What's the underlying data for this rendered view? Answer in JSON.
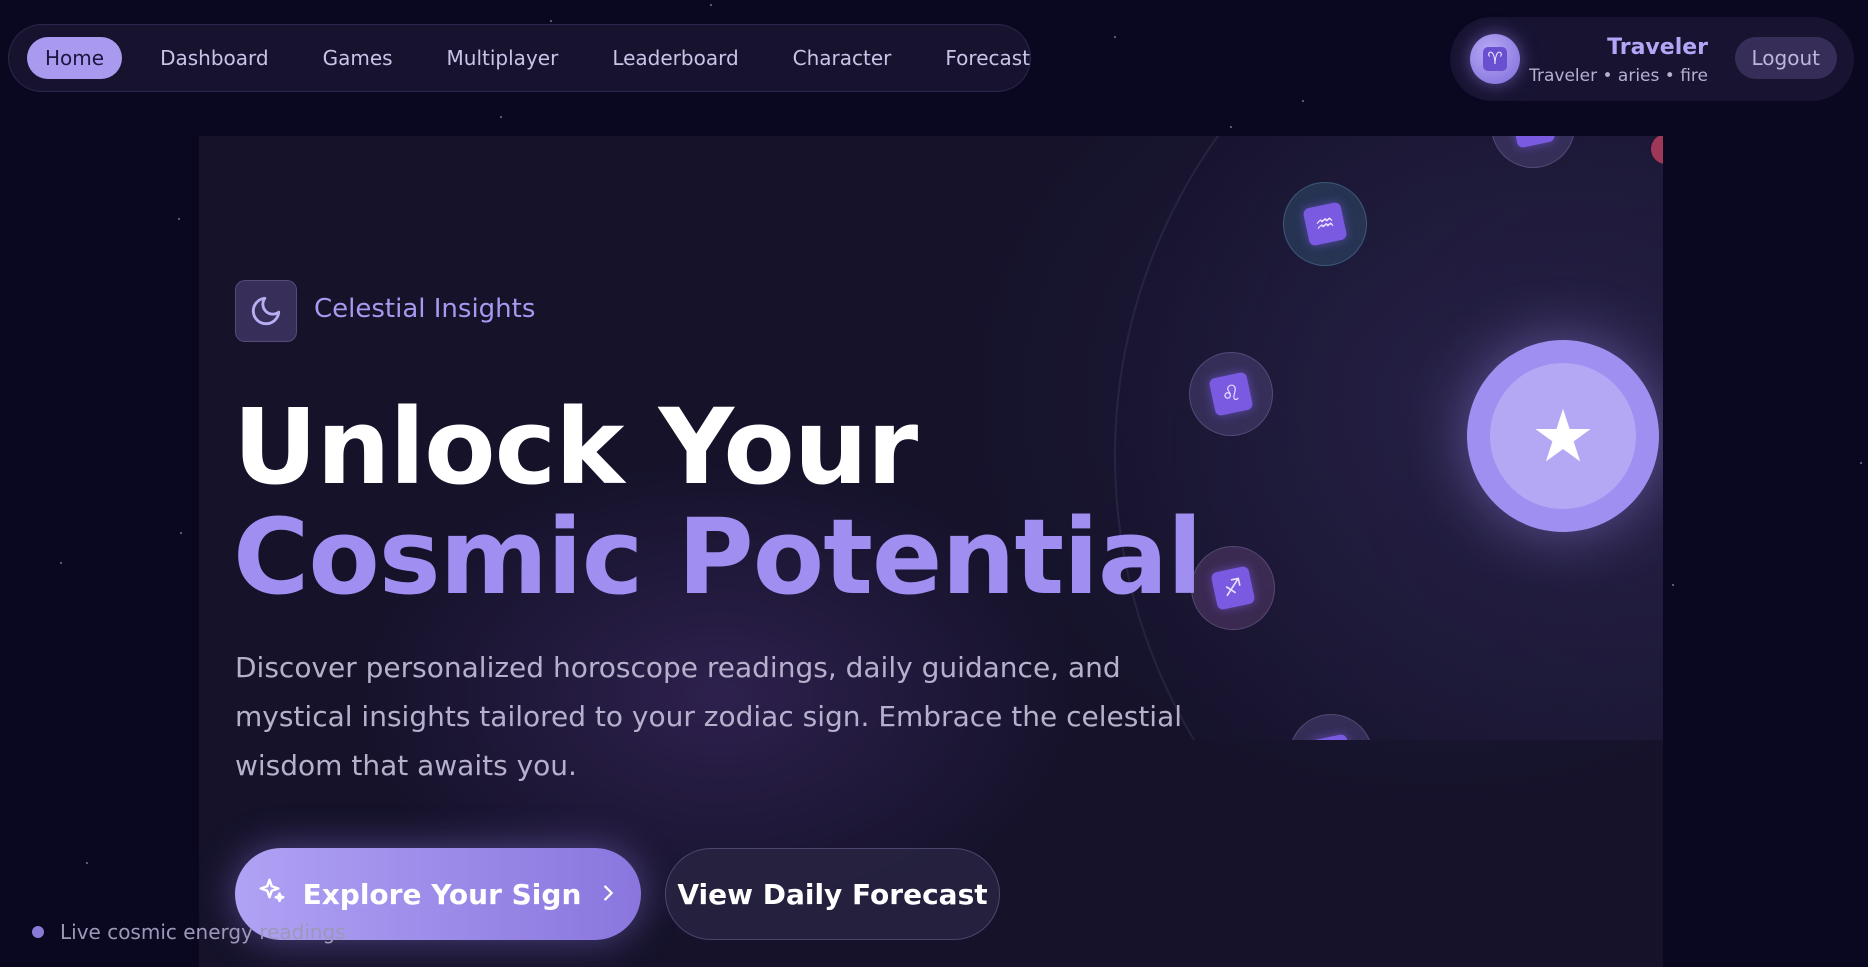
{
  "nav": {
    "items": [
      {
        "label": "Home",
        "active": true
      },
      {
        "label": "Dashboard"
      },
      {
        "label": "Games"
      },
      {
        "label": "Multiplayer"
      },
      {
        "label": "Leaderboard"
      },
      {
        "label": "Character"
      },
      {
        "label": "Forecast"
      }
    ]
  },
  "user": {
    "name": "Traveler",
    "meta": "Traveler • aries • fire",
    "avatar_glyph": "♈",
    "logout_label": "Logout"
  },
  "hero": {
    "badge_label": "Celestial Insights",
    "headline_line1": "Unlock Your",
    "headline_line2": "Cosmic Potential",
    "description": "Discover personalized horoscope readings, daily guidance, and mystical insights tailored to your zodiac sign. Embrace the celestial wisdom that awaits you.",
    "primary_button": "Explore Your Sign",
    "secondary_button": "View Daily Forecast",
    "zodiac_signs": [
      {
        "glyph": "♒",
        "icon": "aquarius-icon"
      },
      {
        "glyph": "♌",
        "icon": "leo-icon"
      },
      {
        "glyph": "♐",
        "icon": "sagittarius-icon"
      },
      {
        "glyph": "♑",
        "icon": "capricorn-icon"
      },
      {
        "glyph": "♓",
        "icon": "pisces-icon"
      }
    ]
  },
  "footer": {
    "live_label": "Live cosmic energy readings"
  },
  "colors": {
    "accent": "#a99af0",
    "background": "#0a0820",
    "panel": "#15122a"
  }
}
